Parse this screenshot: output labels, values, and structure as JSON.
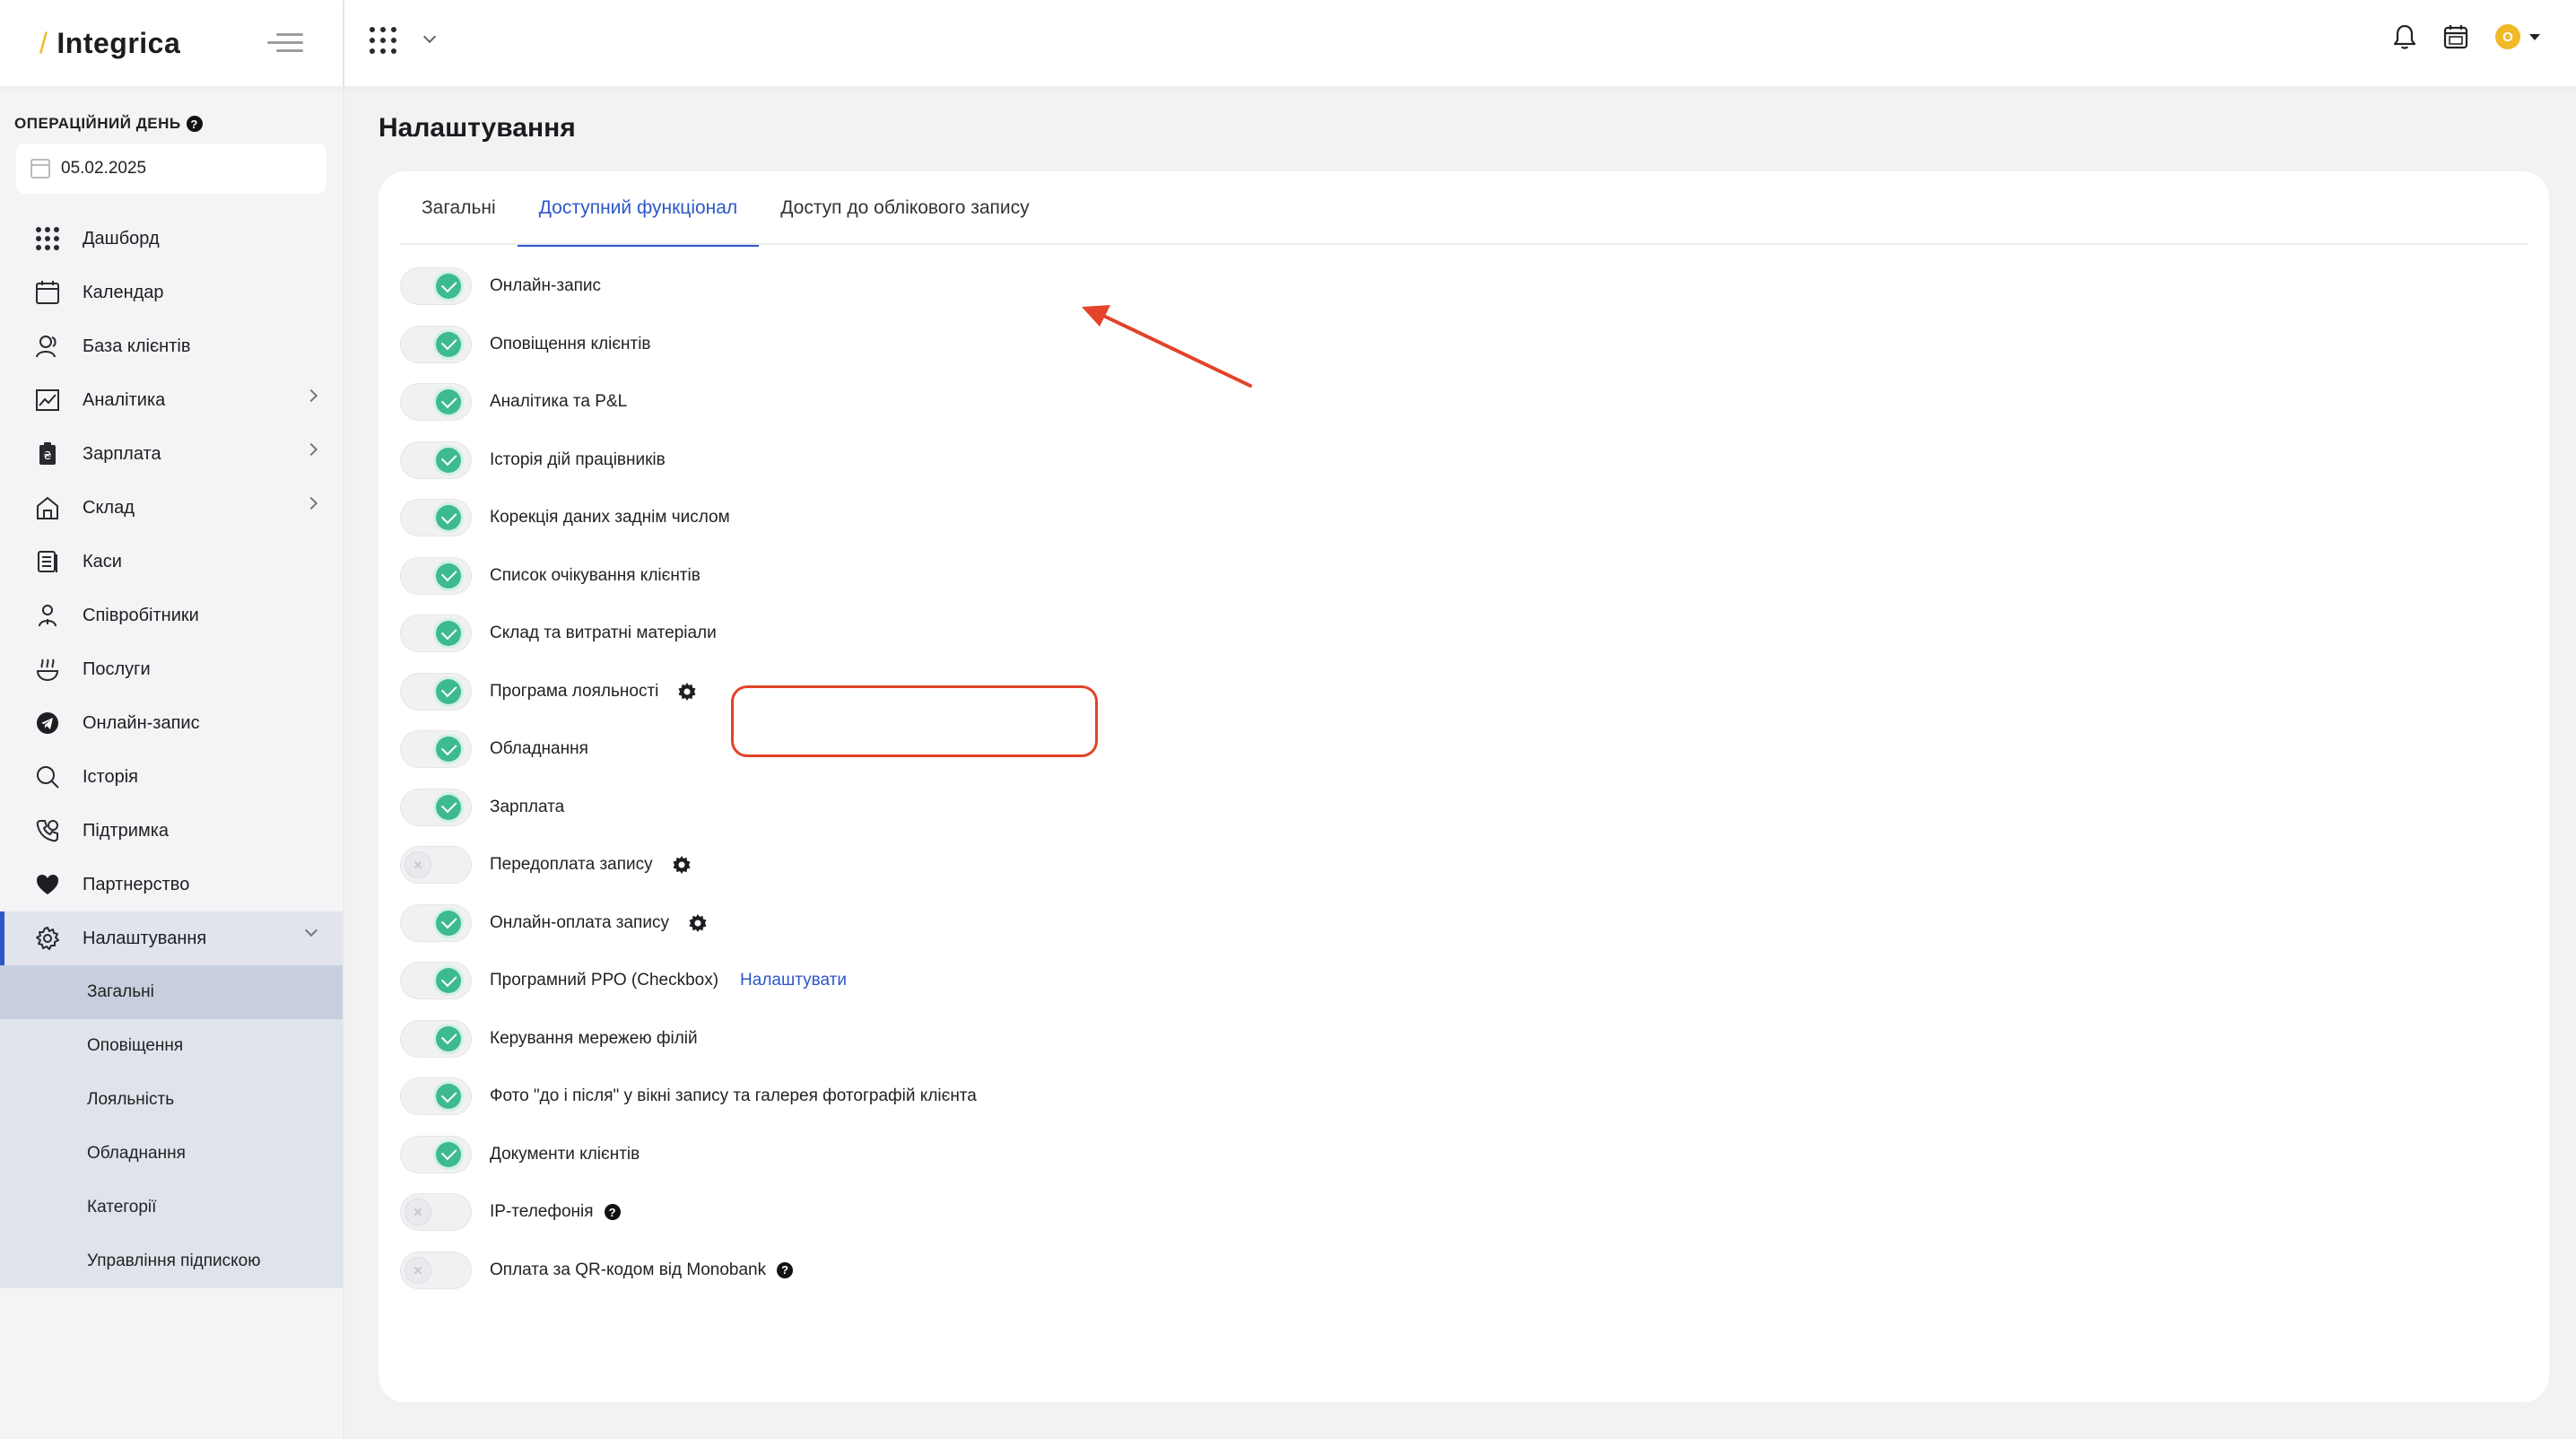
{
  "brand": {
    "name": "Integrica",
    "slash": "/"
  },
  "sidebar": {
    "opday_label": "ОПЕРАЦІЙНИЙ ДЕНЬ",
    "date_value": "05.02.2025",
    "items": [
      {
        "label": "Дашборд",
        "icon": "grid-icon"
      },
      {
        "label": "Календар",
        "icon": "calendar-icon"
      },
      {
        "label": "База клієнтів",
        "icon": "clients-icon"
      },
      {
        "label": "Аналітика",
        "icon": "chart-icon",
        "chevron": true
      },
      {
        "label": "Зарплата",
        "icon": "salary-icon",
        "chevron": true
      },
      {
        "label": "Склад",
        "icon": "warehouse-icon",
        "chevron": true
      },
      {
        "label": "Каси",
        "icon": "cash-icon"
      },
      {
        "label": "Співробітники",
        "icon": "staff-icon"
      },
      {
        "label": "Послуги",
        "icon": "services-icon"
      },
      {
        "label": "Онлайн-запис",
        "icon": "telegram-icon"
      },
      {
        "label": "Історія",
        "icon": "search-icon"
      },
      {
        "label": "Підтримка",
        "icon": "support-icon"
      },
      {
        "label": "Партнерство",
        "icon": "heart-icon"
      },
      {
        "label": "Налаштування",
        "icon": "gear-icon",
        "active": true
      }
    ],
    "submenu": [
      {
        "label": "Загальні",
        "active": true
      },
      {
        "label": "Оповіщення"
      },
      {
        "label": "Лояльність"
      },
      {
        "label": "Обладнання"
      },
      {
        "label": "Категорії"
      },
      {
        "label": "Управління підпискою"
      }
    ]
  },
  "topbar": {
    "avatar_initial": "O"
  },
  "page": {
    "title": "Налаштування",
    "tabs": [
      {
        "label": "Загальні"
      },
      {
        "label": "Доступний функціонал",
        "active": true
      },
      {
        "label": "Доступ до облікового запису"
      }
    ],
    "features": [
      {
        "label": "Онлайн-запис",
        "on": true
      },
      {
        "label": "Оповіщення клієнтів",
        "on": true
      },
      {
        "label": "Аналітика та P&L",
        "on": true
      },
      {
        "label": "Історія дій працівників",
        "on": true
      },
      {
        "label": "Корекція даних заднім числом",
        "on": true
      },
      {
        "label": "Список очікування клієнтів",
        "on": true
      },
      {
        "label": "Склад та витратні матеріали",
        "on": true
      },
      {
        "label": "Програма лояльності",
        "on": true,
        "extra": "gear"
      },
      {
        "label": "Обладнання",
        "on": true
      },
      {
        "label": "Зарплата",
        "on": true
      },
      {
        "label": "Передоплата запису",
        "on": false,
        "extra": "gear"
      },
      {
        "label": "Онлайн-оплата запису",
        "on": true,
        "extra": "gear"
      },
      {
        "label": "Програмний РРО (Checkbox)",
        "on": true,
        "extra": "link",
        "link_label": "Налаштувати"
      },
      {
        "label": "Керування мережею філій",
        "on": true
      },
      {
        "label": "Фото \"до і після\" у вікні запису та галерея фотографій клієнта",
        "on": true
      },
      {
        "label": "Документи клієнтів",
        "on": true
      },
      {
        "label": "IP-телефонія",
        "on": false,
        "extra": "help"
      },
      {
        "label": "Оплата за QR-кодом від Monobank",
        "on": false,
        "extra": "help"
      }
    ]
  },
  "colors": {
    "accent": "#2d57c9",
    "toggle_on": "#3dba92",
    "brand_yellow": "#f0b928",
    "annotation": "#e24329"
  }
}
